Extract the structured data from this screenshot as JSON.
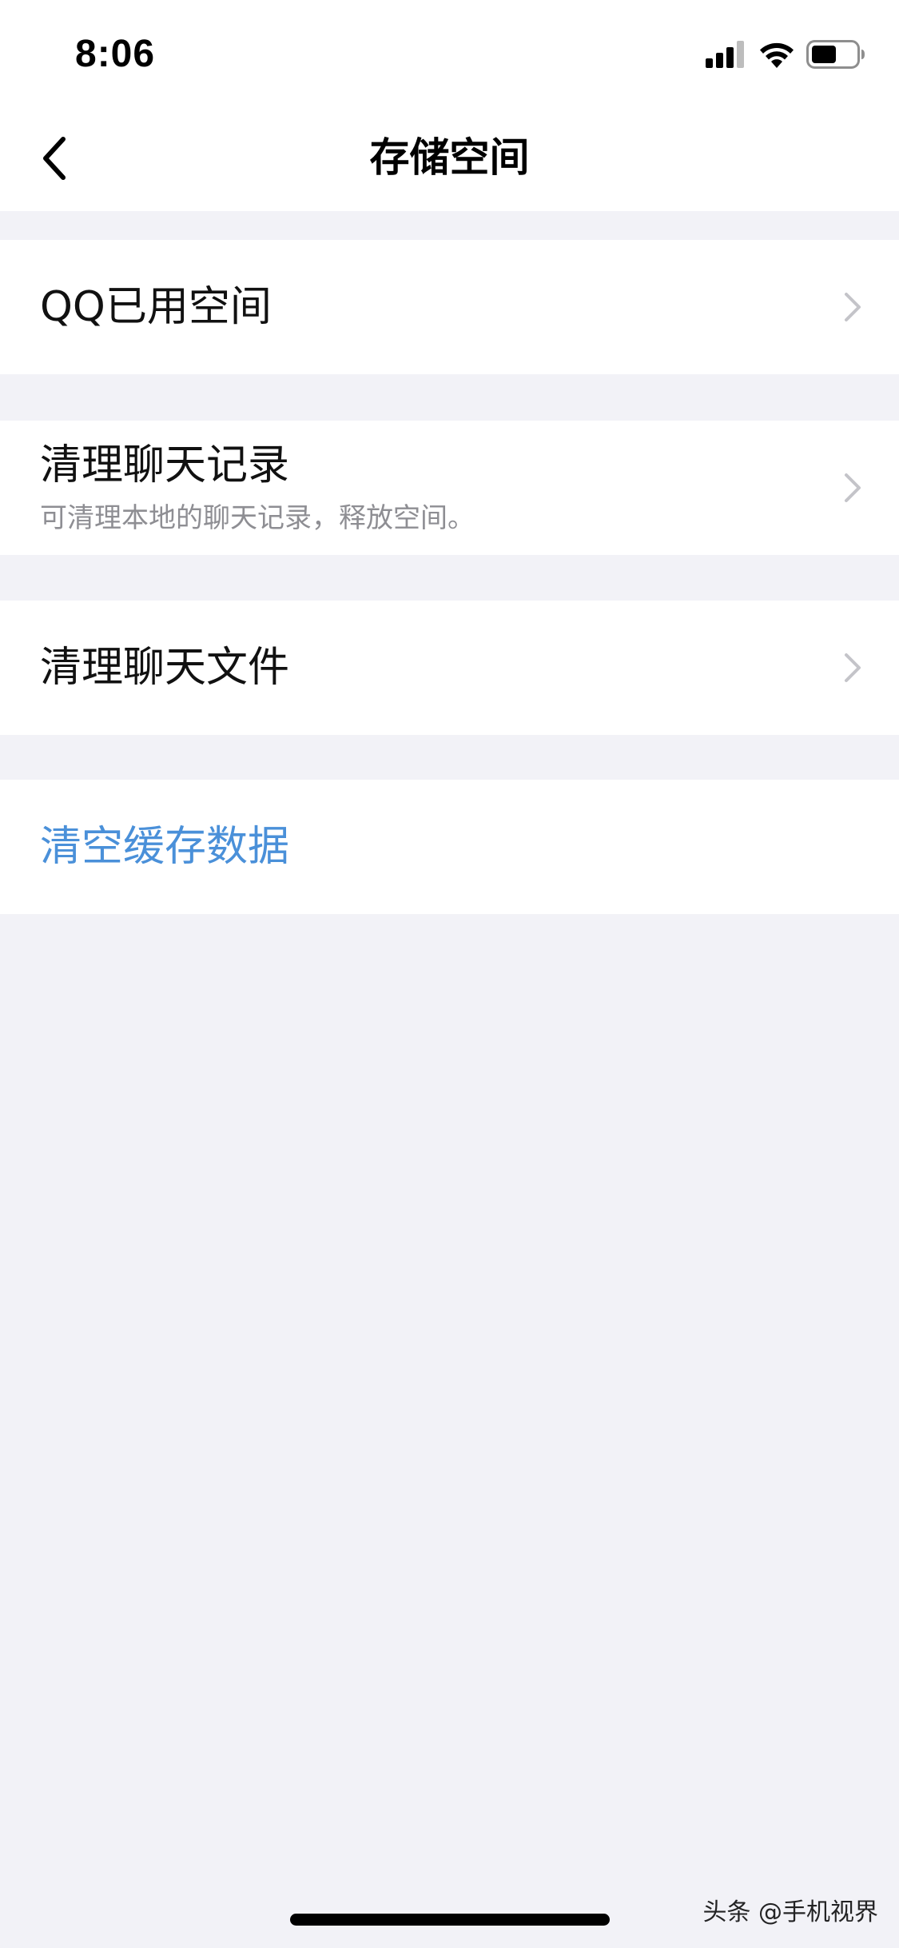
{
  "status_bar": {
    "time": "8:06",
    "icons": [
      "cellular-signal-icon",
      "wifi-icon",
      "battery-icon"
    ]
  },
  "nav": {
    "title": "存储空间",
    "back_icon": "chevron-left-icon"
  },
  "items": [
    {
      "title": "QQ已用空间",
      "subtitle": ""
    },
    {
      "title": "清理聊天记录",
      "subtitle": "可清理本地的聊天记录，释放空间。"
    },
    {
      "title": "清理聊天文件",
      "subtitle": ""
    }
  ],
  "action": {
    "label": "清空缓存数据",
    "color": "#4a90d9"
  },
  "watermark": "头条 @手机视界",
  "colors": {
    "background": "#f2f2f7",
    "cell": "#ffffff",
    "chevron": "#c4c4c9",
    "subtitle": "#8e8e93"
  }
}
